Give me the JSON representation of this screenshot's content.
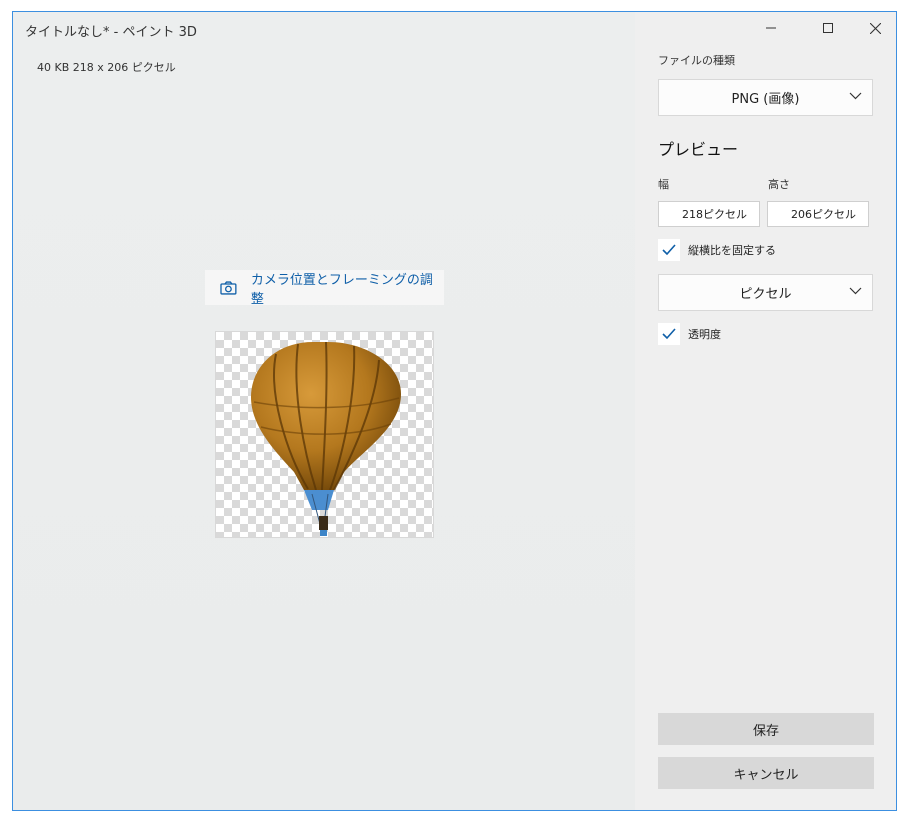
{
  "window": {
    "title": "タイトルなし* - ペイント 3D",
    "controls": [
      "minimize-icon",
      "maximize-icon",
      "close-icon"
    ]
  },
  "file_info": "40 KB    218 x 206 ピクセル",
  "camera_button": {
    "label": "カメラ位置とフレーミングの調整",
    "icon": "camera-icon"
  },
  "preview": {
    "image": "hot-air-balloon",
    "background": "transparency-checkerboard"
  },
  "panel": {
    "file_type_label": "ファイルの種類",
    "file_type_value": "PNG (画像)",
    "preview_title": "プレビュー",
    "width_label": "幅",
    "height_label": "高さ",
    "width_value": "218ピクセル",
    "height_value": "206ピクセル",
    "lock_aspect_label": "縦横比を固定する",
    "lock_aspect_checked": true,
    "unit_value": "ピクセル",
    "transparency_label": "透明度",
    "transparency_checked": true,
    "save_label": "保存",
    "cancel_label": "キャンセル"
  },
  "colors": {
    "accent": "#0f5fa8",
    "window_border": "#3c8fe0",
    "button_bg": "#d8d8d8"
  }
}
